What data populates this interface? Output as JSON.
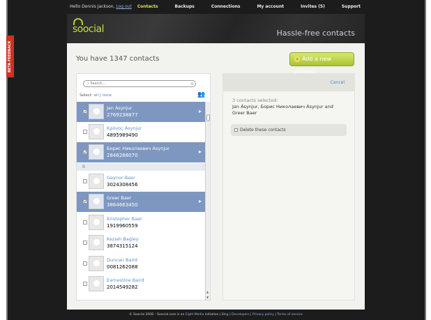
{
  "topbar": {
    "greeting": "Hello Dennis Jackson,",
    "logout": "Log out",
    "nav": [
      "Contacts",
      "Backups",
      "Connections",
      "My account",
      "Invites (5)",
      "Support"
    ]
  },
  "banner": {
    "logo": "soocial",
    "tagline": "Hassle-free contacts"
  },
  "beta": "BETA FEEDBACK",
  "main": {
    "heading": "You have 1347 contacts",
    "add_button": "Add a new contact",
    "search_placeholder": "Search...",
    "select_label": "Select:",
    "select_all": "all",
    "select_sep": "|",
    "select_none": "none"
  },
  "contacts": [
    {
      "name": "Jan Ásynjur",
      "phone": "2769238877",
      "selected": true
    },
    {
      "name": "Κρόνος Ásynjur",
      "phone": "4895989490",
      "selected": false
    },
    {
      "name": "Борис Николаевич Ásynjur",
      "phone": "2846288070",
      "selected": true
    },
    {
      "section": "B"
    },
    {
      "name": "Gaynor Baer",
      "phone": "3024308456",
      "selected": false
    },
    {
      "name": "Greer Baer",
      "phone": "3864663450",
      "selected": true
    },
    {
      "name": "Kristopher Baer",
      "phone": "1919960559",
      "selected": false
    },
    {
      "name": "Keziah Bagley",
      "phone": "3874315124",
      "selected": false
    },
    {
      "name": "Duncan Baird",
      "phone": "0081262088",
      "selected": false
    },
    {
      "name": "Earnestine Baird",
      "phone": "2014549282",
      "selected": false
    }
  ],
  "right": {
    "cancel": "Cancel",
    "count": "3 contacts selected:",
    "names": "Jan Ásynjur, Борис Николаевич Ásynjur and Greer Baer",
    "delete": "Delete these contacts"
  },
  "footer": {
    "text1": "© Soocial 2008 – Soocial.com is an",
    "link1": "Eight Media",
    "text2": "initiative |",
    "links": [
      "Blog",
      "Developers",
      "Privacy policy",
      "Terms of service"
    ]
  },
  "colors": {
    "selected_row": "#7e97c1",
    "accent_green": "#b5cc3a",
    "link_blue": "#4f86c6",
    "beta_red": "#cc3322"
  }
}
